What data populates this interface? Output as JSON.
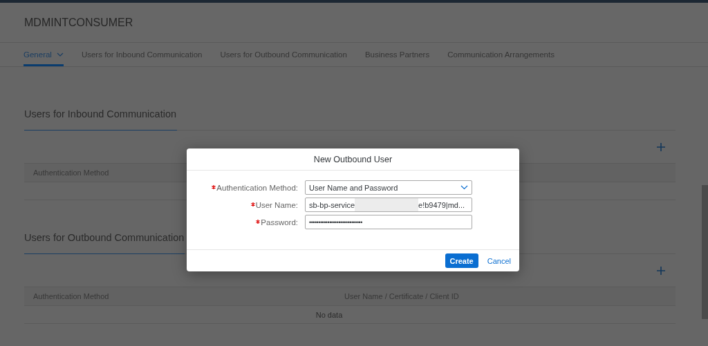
{
  "page": {
    "title": "MDMINTCONSUMER"
  },
  "tabs": [
    {
      "label": "General",
      "selected": true,
      "has_menu": true
    },
    {
      "label": "Users for Inbound Communication",
      "selected": false,
      "has_menu": false
    },
    {
      "label": "Users for Outbound Communication",
      "selected": false,
      "has_menu": false
    },
    {
      "label": "Business Partners",
      "selected": false,
      "has_menu": false
    },
    {
      "label": "Communication Arrangements",
      "selected": false,
      "has_menu": false
    }
  ],
  "sections": [
    {
      "title": "Users for Inbound Communication",
      "columns": [
        "Authentication Method"
      ]
    },
    {
      "title": "Users for Outbound Communication",
      "columns": [
        "Authentication Method",
        "User Name / Certificate / Client ID"
      ],
      "no_data": "No data"
    }
  ],
  "dialog": {
    "title": "New Outbound User",
    "fields": [
      {
        "kind": "select",
        "label": "Authentication Method:",
        "required": true,
        "value": "User Name and Password"
      },
      {
        "kind": "redacted",
        "label": "User Name:",
        "required": true,
        "value_start": "sb-bp-service",
        "value_end": "e!b9479|md..."
      },
      {
        "kind": "password",
        "label": "Password:",
        "required": true,
        "value": "•••••••••••••••••••••••••••••"
      }
    ],
    "buttons": [
      {
        "label": "Create",
        "kind": "primary"
      },
      {
        "label": "Cancel",
        "kind": "link"
      }
    ]
  }
}
